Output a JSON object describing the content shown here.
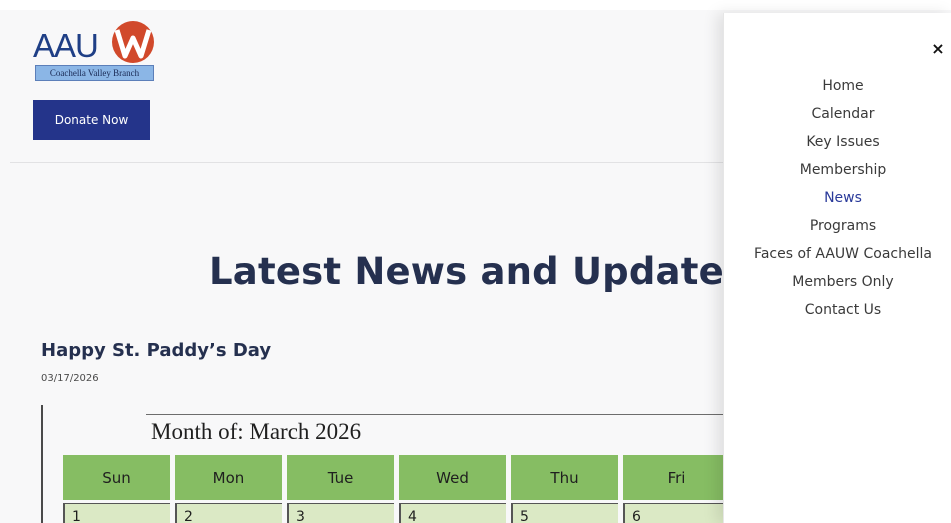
{
  "logo": {
    "text": "AAU",
    "sub": "Coachella Valley Branch"
  },
  "header": {
    "donate_label": "Donate Now"
  },
  "main": {
    "headline": "Latest News and Updates",
    "post": {
      "title": "Happy St. Paddy’s Day",
      "date": "03/17/2026"
    },
    "calendar": {
      "title": "Month of: March 2026",
      "days": [
        "Sun",
        "Mon",
        "Tue",
        "Wed",
        "Thu",
        "Fri"
      ],
      "first_row": [
        "1",
        "2",
        "3",
        "4",
        "5",
        "6"
      ]
    }
  },
  "menu": {
    "close_label": "×",
    "items": [
      {
        "label": "Home",
        "active": false
      },
      {
        "label": "Calendar",
        "active": false
      },
      {
        "label": "Key Issues",
        "active": false
      },
      {
        "label": "Membership",
        "active": false
      },
      {
        "label": "News",
        "active": true
      },
      {
        "label": "Programs",
        "active": false
      },
      {
        "label": "Faces of AAUW Coachella",
        "active": false
      },
      {
        "label": "Members Only",
        "active": false
      },
      {
        "label": "Contact Us",
        "active": false
      }
    ]
  },
  "colors": {
    "brand_blue": "#24348a",
    "logo_red": "#d1492b",
    "calendar_green": "#86bd63",
    "active_link": "#2a3a9a"
  }
}
